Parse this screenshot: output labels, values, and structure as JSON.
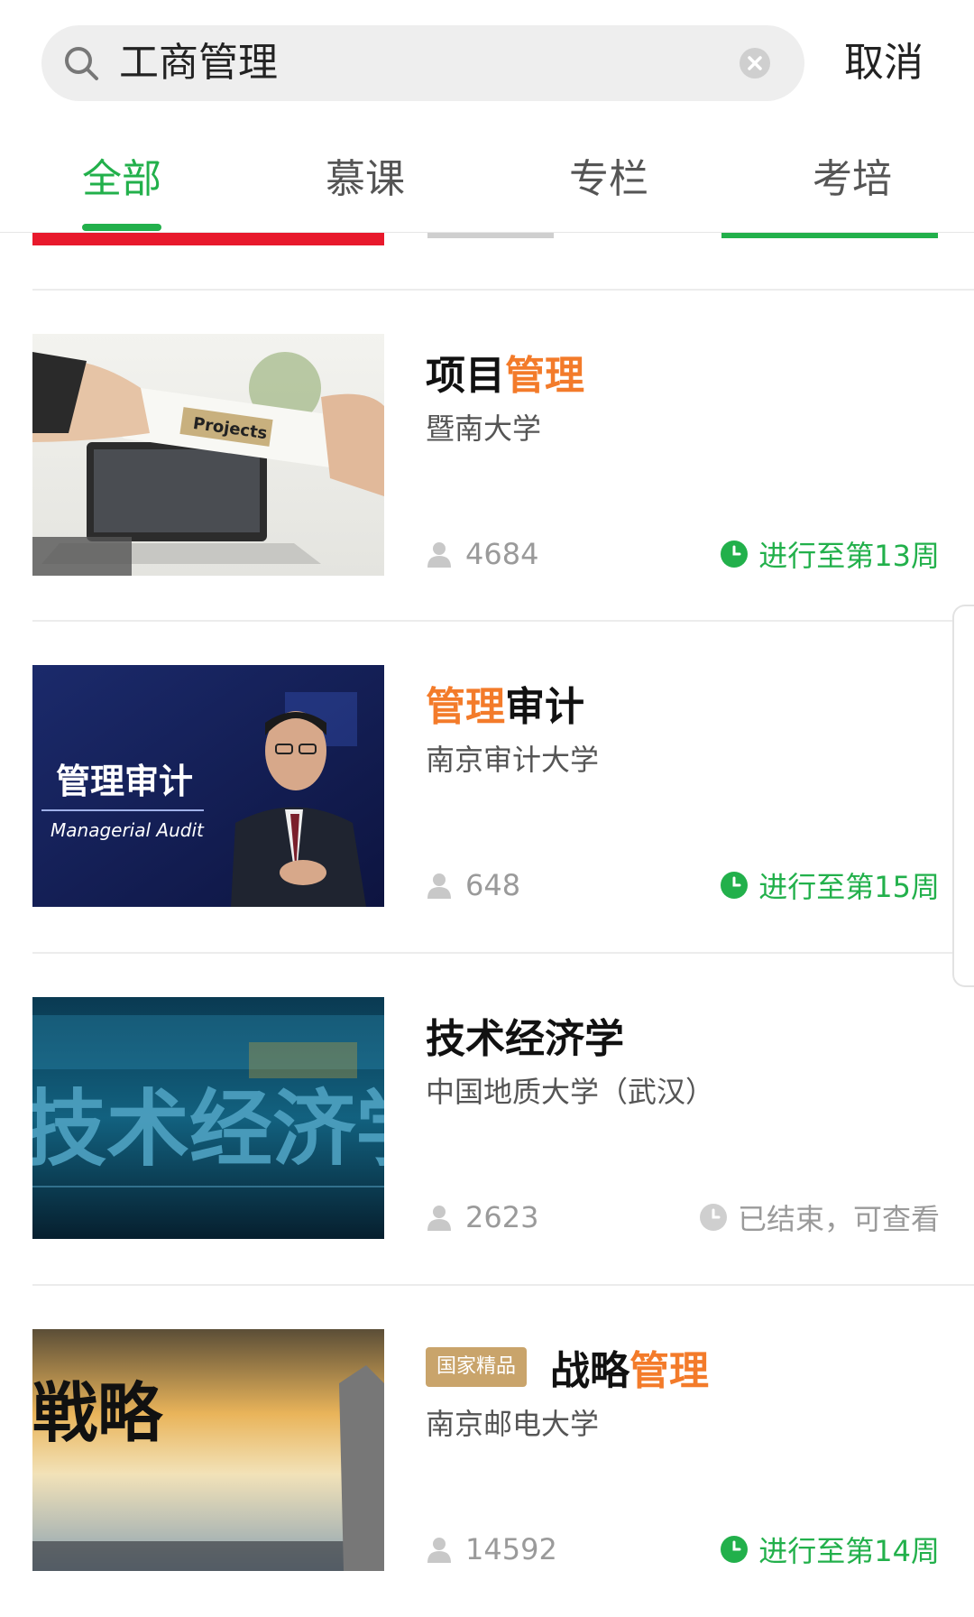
{
  "search": {
    "query": "工商管理",
    "cancel_label": "取消"
  },
  "tabs": [
    {
      "label": "全部",
      "active": true
    },
    {
      "label": "慕课",
      "active": false
    },
    {
      "label": "专栏",
      "active": false
    },
    {
      "label": "考培",
      "active": false
    }
  ],
  "colors": {
    "accent_green": "#22b04b",
    "highlight_orange": "#f37b2a",
    "badge_gold": "#c9a46b"
  },
  "courses": [
    {
      "title_parts": [
        {
          "text": "项目",
          "hl": false
        },
        {
          "text": "管理",
          "hl": true
        }
      ],
      "school": "暨南大学",
      "enrolled": "4684",
      "status": "进行至第13周",
      "status_type": "ongoing",
      "thumb_text": "Projects"
    },
    {
      "title_parts": [
        {
          "text": "管理",
          "hl": true
        },
        {
          "text": "审计",
          "hl": false
        }
      ],
      "school": "南京审计大学",
      "enrolled": "648",
      "status": "进行至第15周",
      "status_type": "ongoing",
      "thumb_title": "管理审计",
      "thumb_subtitle": "Managerial Audit"
    },
    {
      "title_parts": [
        {
          "text": "技术经济学",
          "hl": false
        }
      ],
      "school": "中国地质大学（武汉）",
      "enrolled": "2623",
      "status": "已结束，可查看",
      "status_type": "ended",
      "thumb_text": "技术经济学"
    },
    {
      "badge": "国家精品",
      "title_parts": [
        {
          "text": "战略",
          "hl": false
        },
        {
          "text": "管理",
          "hl": true
        }
      ],
      "school": "南京邮电大学",
      "enrolled": "14592",
      "status": "进行至第14周",
      "status_type": "ongoing",
      "thumb_text": "戦略"
    }
  ]
}
